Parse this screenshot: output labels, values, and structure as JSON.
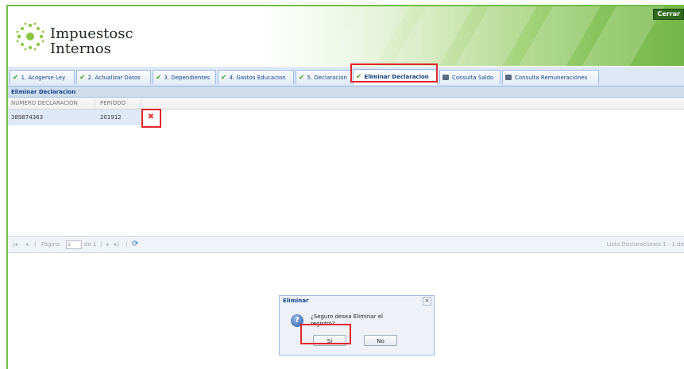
{
  "header": {
    "brand_line1": "Impuestosc",
    "brand_line2": "Internos",
    "close_label": "Cerrar"
  },
  "tabs": [
    {
      "label": "1. Acogerse Ley",
      "icon": "check-icon"
    },
    {
      "label": "2. Actualizar Datos",
      "icon": "check-icon"
    },
    {
      "label": "3. Dependientes",
      "icon": "check-icon"
    },
    {
      "label": "4. Gastos Educacion",
      "icon": "check-icon"
    },
    {
      "label": "5. Declaracion",
      "icon": "check-icon"
    },
    {
      "label": "Eliminar Declaracion",
      "icon": "check-icon",
      "active": true
    },
    {
      "label": "Consulta Saldo",
      "icon": "building-icon"
    },
    {
      "label": "Consulta Remuneraciones",
      "icon": "building-icon"
    }
  ],
  "panel": {
    "title": "Eliminar Declaracion"
  },
  "grid": {
    "columns": [
      "NUMERO DECLARACION",
      "PERIODO"
    ],
    "rows": [
      {
        "numero": "389874363",
        "periodo": "201912"
      }
    ],
    "delete_icon": "delete-x-icon"
  },
  "pager": {
    "page_label": "Página",
    "page_value": "1",
    "of_label": "de 1",
    "summary": "Lista Declaraciones 1 - 1 de"
  },
  "dialog": {
    "title": "Eliminar",
    "message": "¿Seguro desea Eliminar el registro?",
    "yes_label": "Si",
    "no_label": "No",
    "close_glyph": "×",
    "icon": "question-icon"
  },
  "colors": {
    "brand_green": "#6fbe44",
    "tab_text": "#15428b",
    "highlight_red": "#e0262b",
    "delete_red": "#d93a3a"
  }
}
